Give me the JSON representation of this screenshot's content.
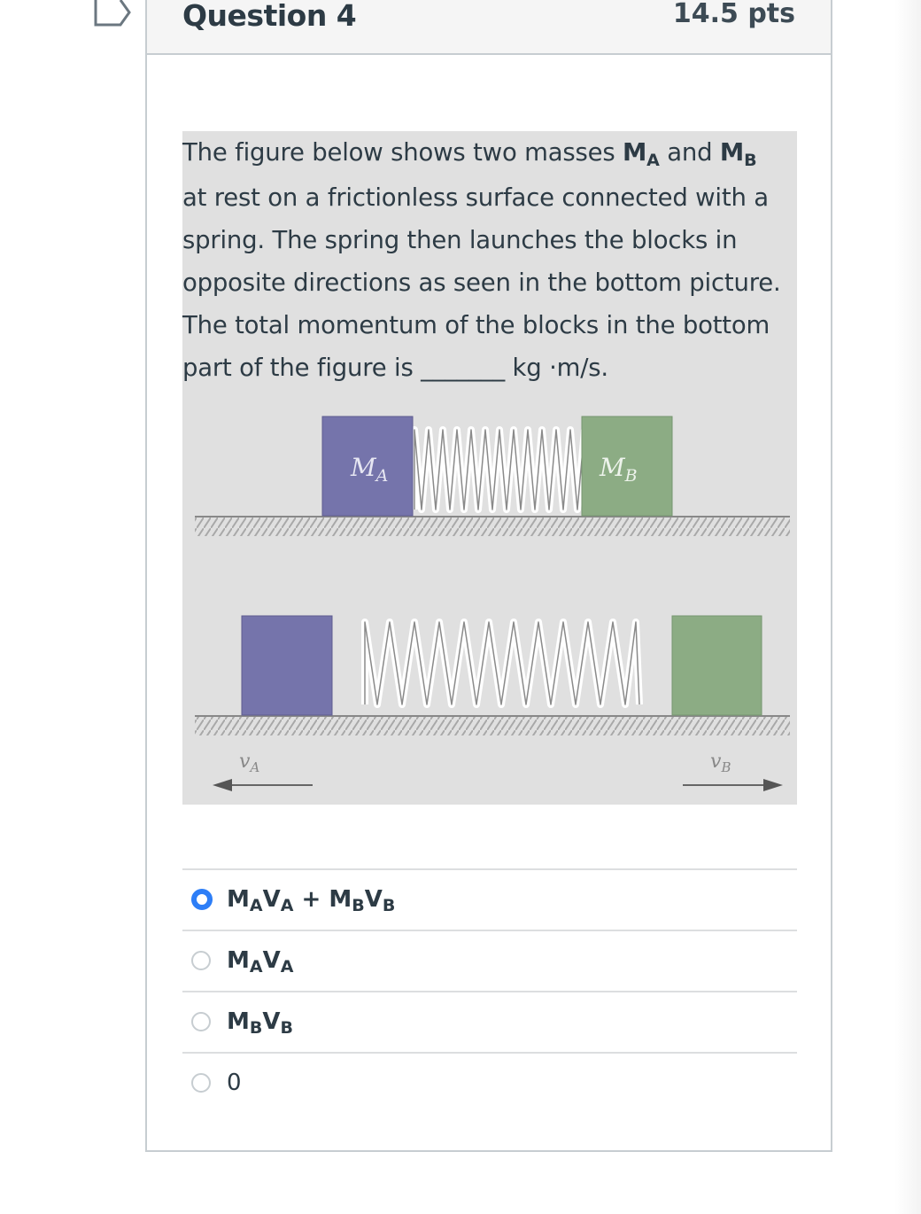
{
  "question": {
    "title": "Question 4",
    "points": "14.5 pts"
  },
  "text": {
    "line1_a": "The figure below shows two masses ",
    "m": "M",
    "a": "A",
    "and": " and ",
    "b": "B",
    "line2": "at rest on a frictionless surface connected with a",
    "line3": "spring.  The spring then launches the blocks in",
    "line4": "opposite directions as seen in the bottom picture.",
    "line5": " The total momentum of the blocks in the bottom",
    "line6_a": "part of the figure is ",
    "blank": "_______",
    "line6_b": " kg ·m/s."
  },
  "figure": {
    "top_block_a_label": "M",
    "top_block_a_sub": "A",
    "top_block_b_label": "M",
    "top_block_b_sub": "B",
    "vel_a_label": "v",
    "vel_a_sub": "A",
    "vel_b_label": "v",
    "vel_b_sub": "B",
    "colors": {
      "block_a": "#7574ab",
      "block_b": "#8cac84",
      "panel": "#e0e0e0",
      "spring": "#ffffff"
    }
  },
  "answers": [
    {
      "parts": [
        [
          "M",
          "A"
        ],
        [
          "V",
          "A"
        ],
        [
          " + M",
          "B"
        ],
        [
          "V",
          "B"
        ]
      ],
      "selected": true
    },
    {
      "parts": [
        [
          "M",
          "A"
        ],
        [
          "V",
          "A"
        ]
      ],
      "selected": false
    },
    {
      "parts": [
        [
          "M",
          "B"
        ],
        [
          "V",
          "B"
        ]
      ],
      "selected": false
    },
    {
      "text": "0",
      "selected": false
    }
  ],
  "accent_color": "#2d7ef7"
}
